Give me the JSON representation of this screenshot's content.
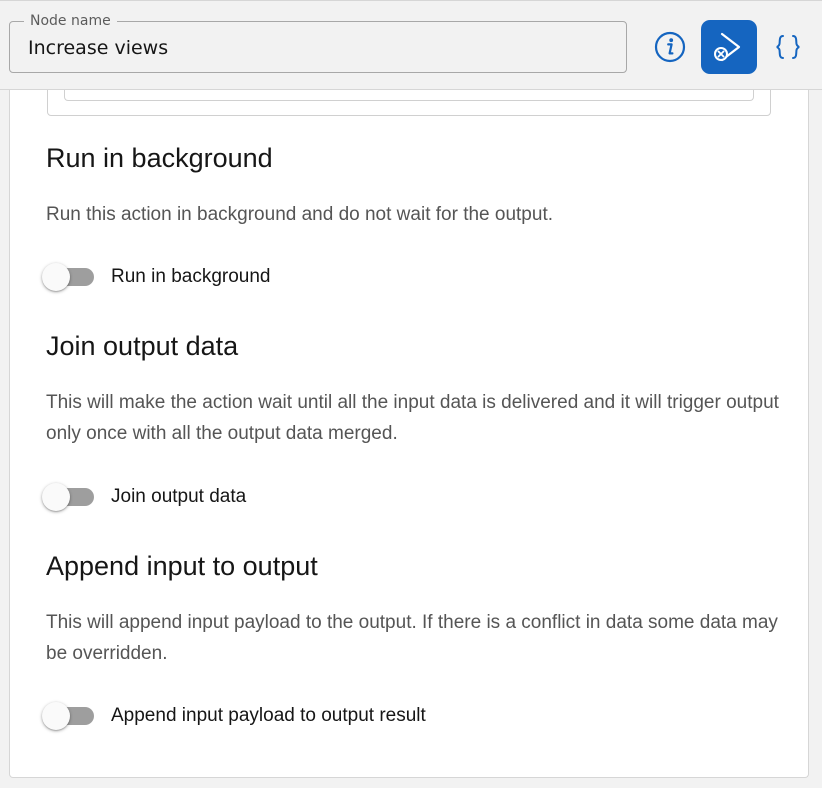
{
  "header": {
    "node_name_label": "Node name",
    "node_name_value": "Increase views",
    "accent_color": "#1565c0",
    "icons": [
      "info-icon",
      "run-flow-icon",
      "json-braces-icon"
    ]
  },
  "sections": [
    {
      "title": "Run in background",
      "description": "Run this action in background and do not wait for the output.",
      "toggle_label": "Run in background",
      "toggle_on": false
    },
    {
      "title": "Join output data",
      "description": "This will make the action wait until all the input data is delivered and it will trigger output only once with all the output data merged.",
      "toggle_label": "Join output data",
      "toggle_on": false
    },
    {
      "title": "Append input to output",
      "description": "This will append input payload to the output. If there is a conflict in data some data may be overridden.",
      "toggle_label": "Append input payload to output result",
      "toggle_on": false
    }
  ]
}
